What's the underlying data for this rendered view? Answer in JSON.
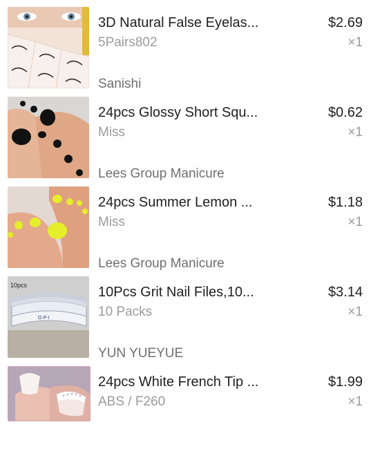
{
  "items": [
    {
      "title": "3D Natural False Eyelas...",
      "variant": "5Pairs802",
      "price": "$2.69",
      "qty": "×1",
      "store": "Sanishi",
      "image_icon": "eyelashes-image"
    },
    {
      "title": "24pcs Glossy Short Squ...",
      "variant": "Miss",
      "price": "$0.62",
      "qty": "×1",
      "store": "Lees Group Manicure",
      "image_icon": "black-toenails-image"
    },
    {
      "title": "24pcs Summer Lemon ...",
      "variant": "Miss",
      "price": "$1.18",
      "qty": "×1",
      "store": "Lees Group Manicure",
      "image_icon": "yellow-toenails-image"
    },
    {
      "title": "10Pcs Grit Nail Files,10...",
      "variant": "10 Packs",
      "price": "$3.14",
      "qty": "×1",
      "store": "YUN YUEYUE",
      "image_icon": "nail-files-image",
      "image_text": "10pcs",
      "image_brand": "O·P·I"
    },
    {
      "title": "24pcs White French Tip ...",
      "variant": "ABS / F260",
      "price": "$1.99",
      "qty": "×1",
      "image_icon": "french-tip-nails-image"
    }
  ]
}
